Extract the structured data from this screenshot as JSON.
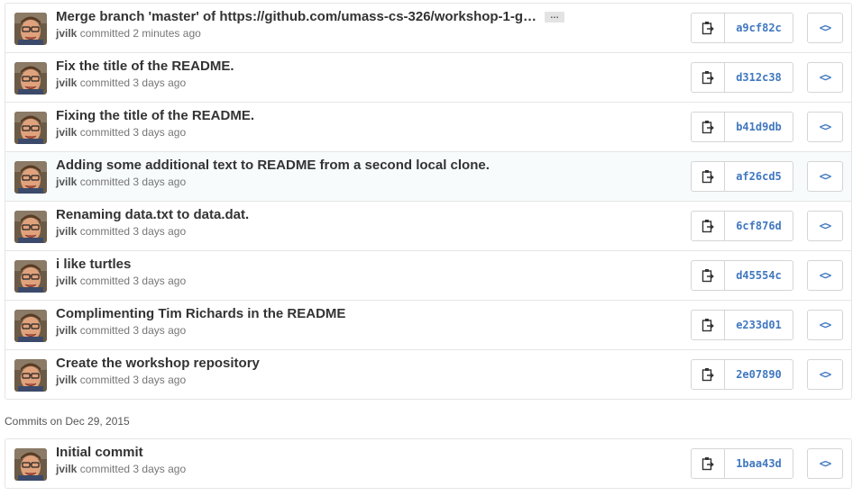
{
  "commit_groups": [
    {
      "commits": [
        {
          "message": "Merge branch 'master' of https://github.com/umass-cs-326/workshop-1-g…",
          "author": "jvilk",
          "committed_text": "committed",
          "time": "2 minutes ago",
          "sha": "a9cf82c",
          "has_ellipsis": true
        },
        {
          "message": "Fix the title of the README.",
          "author": "jvilk",
          "committed_text": "committed",
          "time": "3 days ago",
          "sha": "d312c38"
        },
        {
          "message": "Fixing the title of the README.",
          "author": "jvilk",
          "committed_text": "committed",
          "time": "3 days ago",
          "sha": "b41d9db"
        },
        {
          "message": "Adding some additional text to README from a second local clone.",
          "author": "jvilk",
          "committed_text": "committed",
          "time": "3 days ago",
          "sha": "af26cd5",
          "highlighted": true
        },
        {
          "message": "Renaming data.txt to data.dat.",
          "author": "jvilk",
          "committed_text": "committed",
          "time": "3 days ago",
          "sha": "6cf876d"
        },
        {
          "message": "i like turtles",
          "author": "jvilk",
          "committed_text": "committed",
          "time": "3 days ago",
          "sha": "d45554c"
        },
        {
          "message": "Complimenting Tim Richards in the README",
          "author": "jvilk",
          "committed_text": "committed",
          "time": "3 days ago",
          "sha": "e233d01"
        },
        {
          "message": "Create the workshop repository",
          "author": "jvilk",
          "committed_text": "committed",
          "time": "3 days ago",
          "sha": "2e07890"
        }
      ]
    },
    {
      "heading": "Commits on Dec 29, 2015",
      "commits": [
        {
          "message": "Initial commit",
          "author": "jvilk",
          "committed_text": "committed",
          "time": "3 days ago",
          "sha": "1baa43d"
        }
      ]
    }
  ],
  "ellipsis_label": "…",
  "browse_label": "<>",
  "icons": {
    "avatar": "avatar",
    "copy": "clippy-icon",
    "browse": "code-icon"
  },
  "colors": {
    "link": "#4078c0",
    "border": "#e5e5e5"
  }
}
